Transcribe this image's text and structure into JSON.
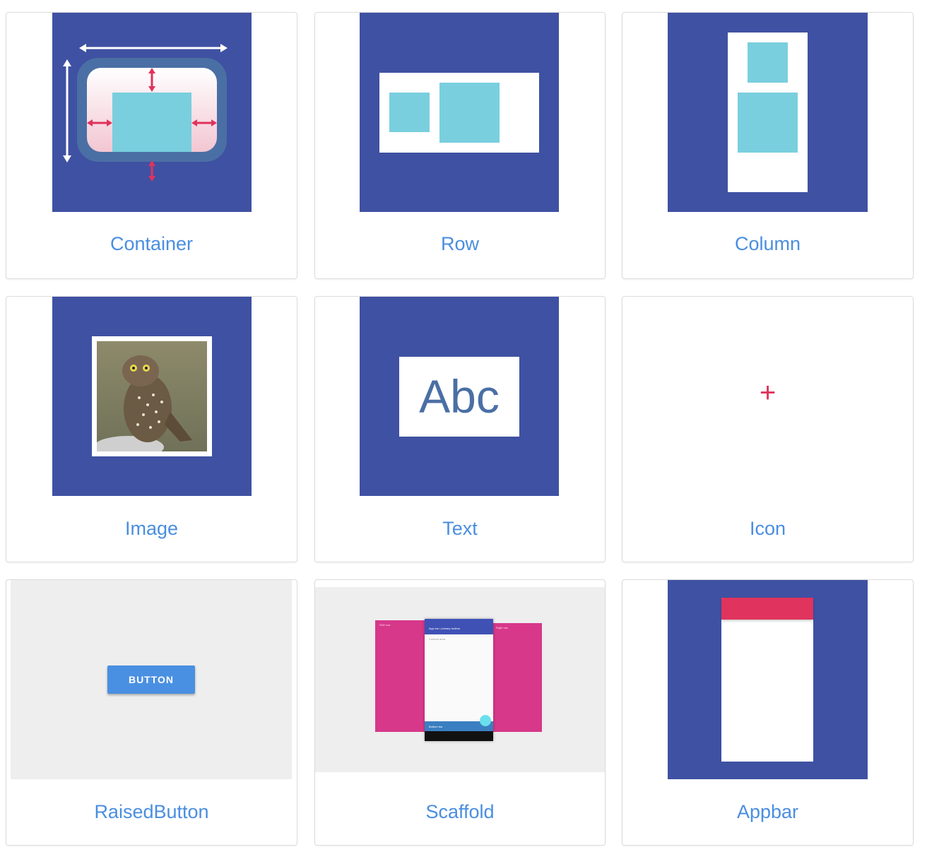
{
  "colors": {
    "thumb_blue": "#3f51a2",
    "teal": "#79cfde",
    "label_blue": "#4a8ee0",
    "accent_pink": "#e0335d",
    "magenta": "#d7388a",
    "button_blue": "#4a90e2"
  },
  "widgets": [
    {
      "label": "Container"
    },
    {
      "label": "Row"
    },
    {
      "label": "Column"
    },
    {
      "label": "Image"
    },
    {
      "label": "Text"
    },
    {
      "label": "Icon"
    },
    {
      "label": "RaisedButton"
    },
    {
      "label": "Scaffold"
    },
    {
      "label": "Appbar"
    }
  ],
  "text_sample": "Abc",
  "icon_glyph": "+",
  "button_label": "BUTTON",
  "scaffold": {
    "left_nav": "Side nav",
    "app_bar": "App bar / primary toolbar",
    "content": "Content area",
    "right_nav": "Right nav",
    "bottom_bar": "Bottom bar"
  },
  "icons": {
    "container": "resize-arrows-icon",
    "image": "owl-photo",
    "icon_widget": "plus-icon"
  }
}
